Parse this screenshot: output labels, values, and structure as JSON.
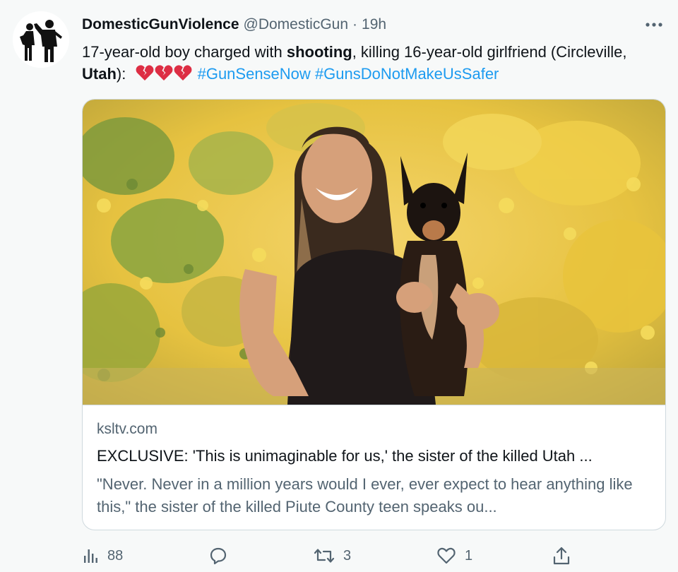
{
  "author": {
    "display_name": "DomesticGunViolence",
    "handle": "@DomesticGun",
    "separator": "·",
    "time": "19h"
  },
  "tweet": {
    "text_part1": "17-year-old boy charged with ",
    "text_bold1": "shooting",
    "text_part2": ", killing 16-year-old girlfriend (Circleville, ",
    "text_bold2": "Utah",
    "text_part3": "):",
    "emoji_icons": [
      "broken-heart-icon",
      "broken-heart-icon",
      "broken-heart-icon"
    ],
    "hashtags": [
      "#GunSenseNow",
      "#GunsDoNotMakeUsSafer"
    ]
  },
  "card": {
    "domain": "ksltv.com",
    "title": "EXCLUSIVE: 'This is unimaginable for us,' the sister of the killed Utah ...",
    "description": "\"Never. Never in a million years would I ever, ever expect to hear anything like this,\" the sister of the killed Piute County teen speaks ou..."
  },
  "actions": {
    "views_icon": "analytics-icon",
    "views_count": "88",
    "reply_icon": "reply-icon",
    "reply_count": "",
    "retweet_icon": "retweet-icon",
    "retweet_count": "3",
    "like_icon": "heart-outline-icon",
    "like_count": "1",
    "share_icon": "share-icon"
  },
  "colors": {
    "link": "#1d9bf0",
    "secondary_text": "#536471",
    "primary_text": "#0f1419",
    "border": "#cfd9de",
    "background": "#f7f9f9"
  }
}
